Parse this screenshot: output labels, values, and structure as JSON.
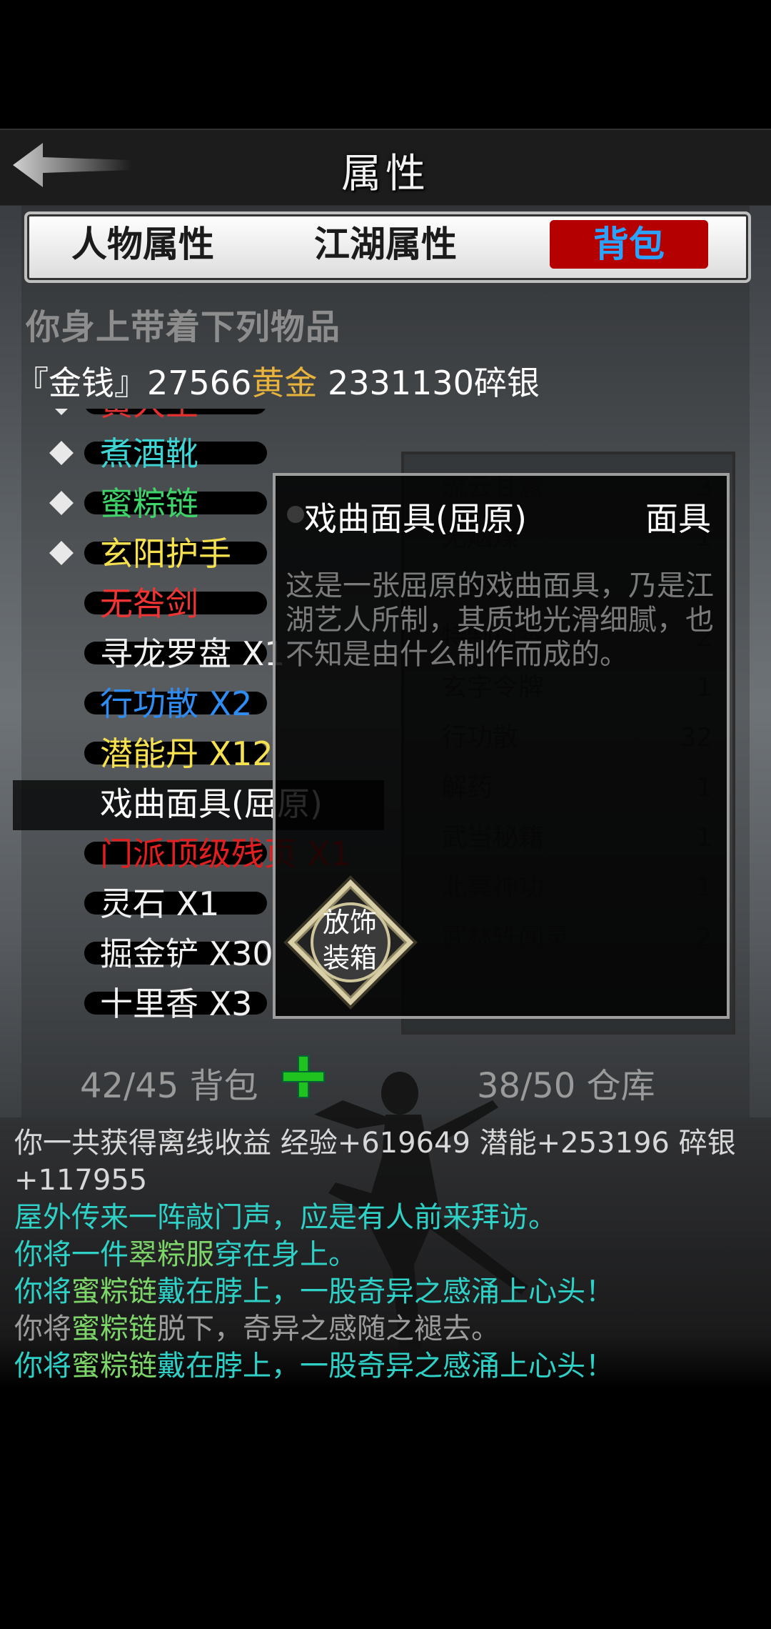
{
  "header": {
    "title": "属性"
  },
  "tabs": [
    {
      "label": "人物属性",
      "active": false
    },
    {
      "label": "江湖属性",
      "active": false
    },
    {
      "label": "背包",
      "active": true
    }
  ],
  "inventory": {
    "heading": "你身上带着下列物品",
    "money_prefix": "『金钱』",
    "gold_amount": "27566",
    "gold_unit": "黄金",
    "silver_amount": " 2331130",
    "silver_unit": "碎银",
    "items": [
      {
        "label": "黄大王",
        "color": "#e03030",
        "equipped": true
      },
      {
        "label": "煮酒靴",
        "color": "#3fd4d4",
        "equipped": true
      },
      {
        "label": "蜜粽链",
        "color": "#3fd46a",
        "equipped": true
      },
      {
        "label": "玄阳护手",
        "color": "#f5e050",
        "equipped": true
      },
      {
        "label": "无咎剑",
        "color": "#ef3434",
        "equipped": false
      },
      {
        "label": "寻龙罗盘 X1",
        "color": "#f0f0f0",
        "equipped": false
      },
      {
        "label": "行功散 X2",
        "color": "#2f8cf0",
        "equipped": false
      },
      {
        "label": "潜能丹 X12",
        "color": "#f5e050",
        "equipped": false
      },
      {
        "label": "戏曲面具(屈原)",
        "color": "#ffffff",
        "equipped": false,
        "selected": true
      },
      {
        "label": "门派顶级残页 X1",
        "color": "#e02020",
        "equipped": false
      },
      {
        "label": "灵石 X1",
        "color": "#f0f0f0",
        "equipped": false
      },
      {
        "label": "掘金铲 X30",
        "color": "#f0f0f0",
        "equipped": false
      },
      {
        "label": "十里香 X3",
        "color": "#f0f0f0",
        "equipped": false
      }
    ],
    "bag_count": "42/45 背包",
    "warehouse_count": "38/50 仓库"
  },
  "warehouse_list": [
    {
      "label": "流云甘露",
      "count": "3"
    },
    {
      "label": "无烟煤",
      "count": "1"
    },
    {
      "label": "九黑香",
      "count": "4"
    },
    {
      "label": "特制檀香",
      "count": "2"
    },
    {
      "label": "玄字令牌",
      "count": "1"
    },
    {
      "label": "行功散",
      "count": "32"
    },
    {
      "label": "解药",
      "count": "1"
    },
    {
      "label": "武当秘籍",
      "count": "1"
    },
    {
      "label": "北冥神功",
      "count": "1"
    },
    {
      "label": "武林轶闻录",
      "count": "2"
    }
  ],
  "popup": {
    "item_name": "戏曲面具(屈原)",
    "item_type": "面具",
    "description": "这是一张屈原的戏曲面具，乃是江湖艺人所制，其质地光滑细腻，也不知是由什么制作而成的。",
    "btn_line1": "放饰",
    "btn_line2": "装箱"
  },
  "log": {
    "line1": "你一共获得离线收益 经验+619649 潜能+253196 碎银+117955",
    "line2": "屋外传来一阵敲门声，应是有人前来拜访。",
    "line3_a": "你将一件",
    "line3_b": "翠粽服",
    "line3_c": "穿在身上。",
    "line4_a": "你将",
    "line4_b": "蜜粽链",
    "line4_c": "戴在脖上，一股奇异之感涌上心头！",
    "line5_a": "你将",
    "line5_b": "蜜粽链",
    "line5_c": "脱下，奇异之感随之褪去。",
    "line6_a": "你将",
    "line6_b": "蜜粽链",
    "line6_c": "戴在脖上，一股奇异之感涌上心头！"
  },
  "colors": {
    "active_tab_bg": "#b50000",
    "active_tab_text": "#2aa3ff",
    "gold": "#e8b33c",
    "log_cyan": "#2fd0c6",
    "log_green": "#7ed66b"
  }
}
